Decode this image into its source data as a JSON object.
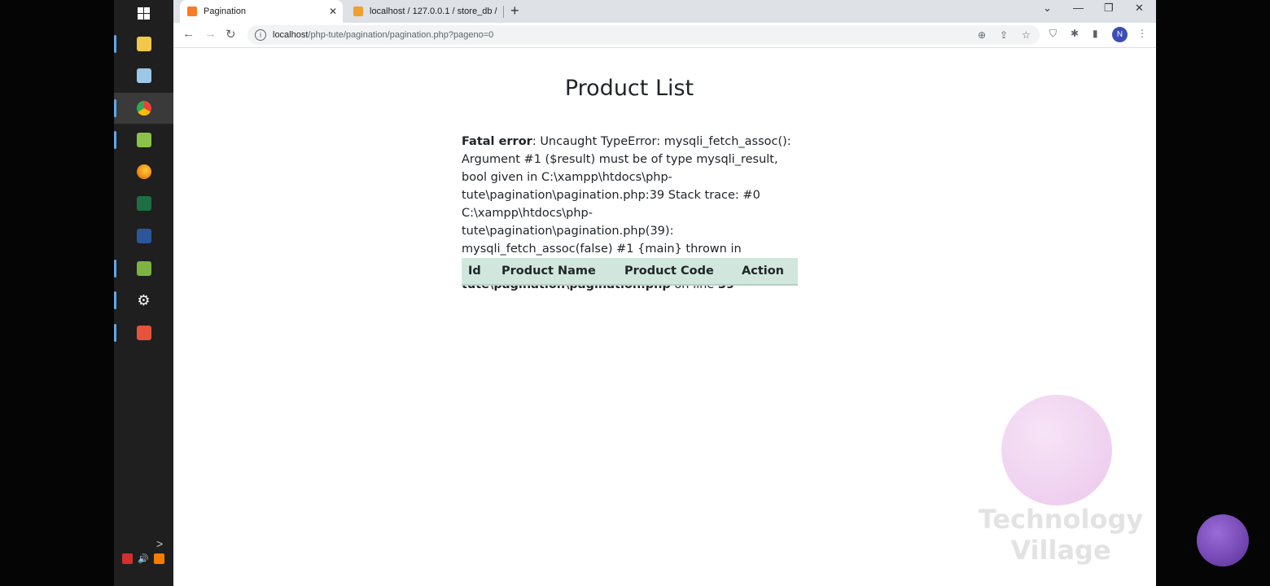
{
  "browser": {
    "tabs": [
      {
        "title": "Pagination",
        "active": true
      },
      {
        "title": "localhost / 127.0.0.1 / store_db / ",
        "active": false
      }
    ],
    "url_host": "localhost",
    "url_path": "/php-tute/pagination/pagination.php?pageno=0",
    "avatar_letter": "N"
  },
  "page": {
    "title": "Product List",
    "error": {
      "label": "Fatal error",
      "message": ": Uncaught TypeError: mysqli_fetch_assoc(): Argument #1 ($result) must be of type mysqli_result, bool given in C:\\xampp\\htdocs\\php-tute\\pagination\\pagination.php:39 Stack trace: #0 C:\\xampp\\htdocs\\php-tute\\pagination\\pagination.php(39): mysqli_fetch_assoc(false) #1 {main} thrown in ",
      "file": "C:\\xampp\\htdocs\\php-tute\\pagination\\pagination.php",
      "on_line": " on line ",
      "line": "39"
    },
    "table_headers": [
      "Id",
      "Product Name",
      "Product Code",
      "Action"
    ]
  },
  "watermark": {
    "line1": "Technology",
    "line2": "Village"
  }
}
